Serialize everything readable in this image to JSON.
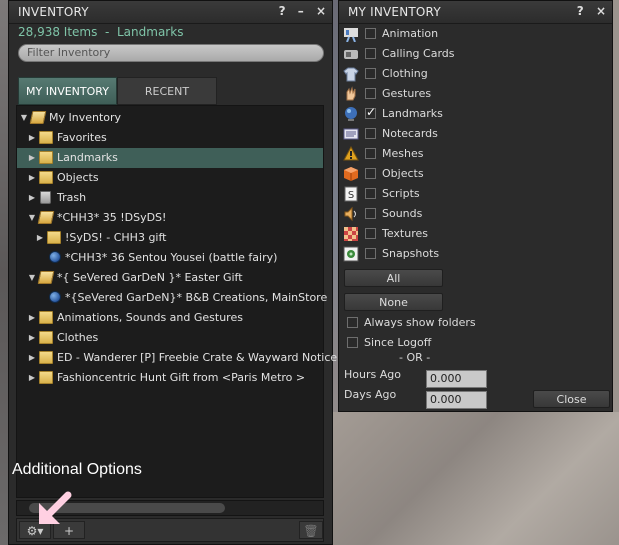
{
  "left_panel": {
    "title": "INVENTORY",
    "controls": {
      "help": "?",
      "minimize": "–",
      "close": "×"
    },
    "item_count": "28,938 Items",
    "separator": "-",
    "filter_label": "Landmarks",
    "filter_placeholder": "Filter Inventory",
    "tabs": [
      {
        "label": "MY INVENTORY"
      },
      {
        "label": "RECENT"
      }
    ],
    "tree": [
      {
        "label": "My Inventory"
      },
      {
        "label": "Favorites"
      },
      {
        "label": "Landmarks"
      },
      {
        "label": "Objects"
      },
      {
        "label": "Trash"
      },
      {
        "label": "*CHH3* 35 !DSyDS!"
      },
      {
        "label": "!SyDS! - CHH3 gift"
      },
      {
        "label": "*CHH3* 36 Sentou Yousei (battle fairy)"
      },
      {
        "label": "*{ SeVered GarDeN }* Easter Gift"
      },
      {
        "label": "*{SeVered GarDeN}* B&B Creations, MainStore"
      },
      {
        "label": "Animations, Sounds and Gestures"
      },
      {
        "label": "Clothes"
      },
      {
        "label": "ED - Wanderer [P] Freebie Crate & Wayward Notice"
      },
      {
        "label": "Fashioncentric Hunt Gift from <Paris Metro >"
      }
    ],
    "annotation": "Additional Options",
    "bottom": {
      "gear": "⚙▾",
      "add": "+",
      "trash": "🗑"
    }
  },
  "right_panel": {
    "title": "MY INVENTORY",
    "controls": {
      "help": "?",
      "close": "×"
    },
    "filters": [
      {
        "label": "Animation",
        "checked": false,
        "icon": "animation-icon"
      },
      {
        "label": "Calling Cards",
        "checked": false,
        "icon": "calling-card-icon"
      },
      {
        "label": "Clothing",
        "checked": false,
        "icon": "clothing-icon"
      },
      {
        "label": "Gestures",
        "checked": false,
        "icon": "gesture-icon"
      },
      {
        "label": "Landmarks",
        "checked": true,
        "icon": "landmark-icon"
      },
      {
        "label": "Notecards",
        "checked": false,
        "icon": "notecard-icon"
      },
      {
        "label": "Meshes",
        "checked": false,
        "icon": "mesh-icon"
      },
      {
        "label": "Objects",
        "checked": false,
        "icon": "object-icon"
      },
      {
        "label": "Scripts",
        "checked": false,
        "icon": "script-icon"
      },
      {
        "label": "Sounds",
        "checked": false,
        "icon": "sound-icon"
      },
      {
        "label": "Textures",
        "checked": false,
        "icon": "texture-icon"
      },
      {
        "label": "Snapshots",
        "checked": false,
        "icon": "snapshot-icon"
      }
    ],
    "all_button": "All",
    "none_button": "None",
    "always_show_folders": "Always show folders",
    "since_logoff": "Since Logoff",
    "or_label": "- OR -",
    "hours_ago_label": "Hours Ago",
    "hours_ago_value": "0.000",
    "days_ago_label": "Days Ago",
    "days_ago_value": "0.000",
    "close_button": "Close"
  }
}
